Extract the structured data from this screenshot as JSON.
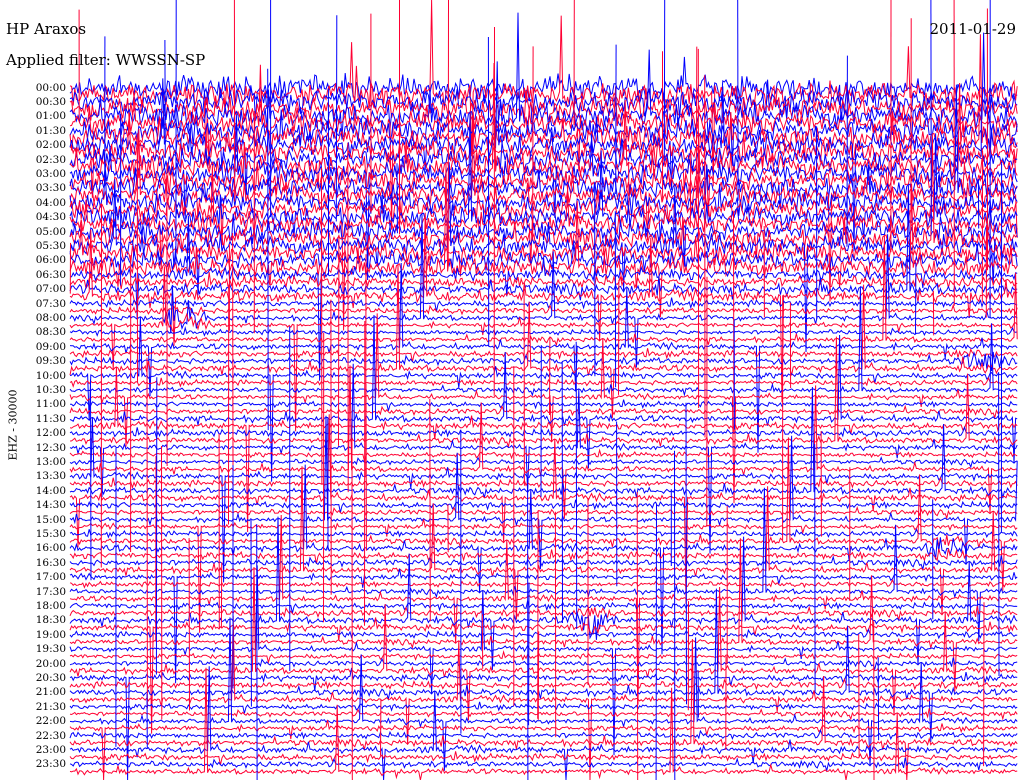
{
  "chart_data": {
    "type": "line",
    "title": "HP Araxos",
    "date": "2011-01-29",
    "filter_label": "Applied filter: WWSSN-SP",
    "ylabel": "EHZ - 30000",
    "y_tick_labels": [
      "00:00",
      "00:30",
      "01:00",
      "01:30",
      "02:00",
      "02:30",
      "03:00",
      "03:30",
      "04:00",
      "04:30",
      "05:00",
      "05:30",
      "06:00",
      "06:30",
      "07:00",
      "07:30",
      "08:00",
      "08:30",
      "09:00",
      "09:30",
      "10:00",
      "10:30",
      "11:00",
      "11:30",
      "12:00",
      "12:30",
      "13:00",
      "13:30",
      "14:00",
      "14:30",
      "15:00",
      "15:30",
      "16:00",
      "16:30",
      "17:00",
      "17:30",
      "18:00",
      "18:30",
      "19:00",
      "19:30",
      "20:00",
      "20:30",
      "21:00",
      "21:30",
      "22:00",
      "22:30",
      "23:00",
      "23:30"
    ],
    "series_colors": [
      "#0000ff",
      "#ff0033"
    ],
    "grid": false,
    "events": [
      {
        "time": "08:00",
        "x_fraction": 0.12,
        "amplitude": "large"
      },
      {
        "time": "18:30",
        "x_fraction": 0.55,
        "amplitude": "large"
      },
      {
        "time": "16:00",
        "x_fraction": 0.92,
        "amplitude": "medium"
      },
      {
        "time": "09:30",
        "x_fraction": 0.96,
        "amplitude": "medium"
      }
    ]
  }
}
